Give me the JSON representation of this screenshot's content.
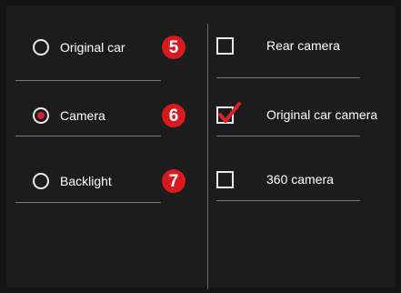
{
  "left_options": [
    {
      "label": "Original car",
      "selected": false,
      "badge": "5"
    },
    {
      "label": "Camera",
      "selected": true,
      "badge": "6"
    },
    {
      "label": "Backlight",
      "selected": false,
      "badge": "7"
    }
  ],
  "right_options": [
    {
      "label": "Rear camera",
      "checked": false
    },
    {
      "label": "Original car camera",
      "checked": true
    },
    {
      "label": "360 camera",
      "checked": false
    }
  ],
  "colors": {
    "accent": "#d71920",
    "check": "#e0202a",
    "background": "#1c1c1c"
  }
}
